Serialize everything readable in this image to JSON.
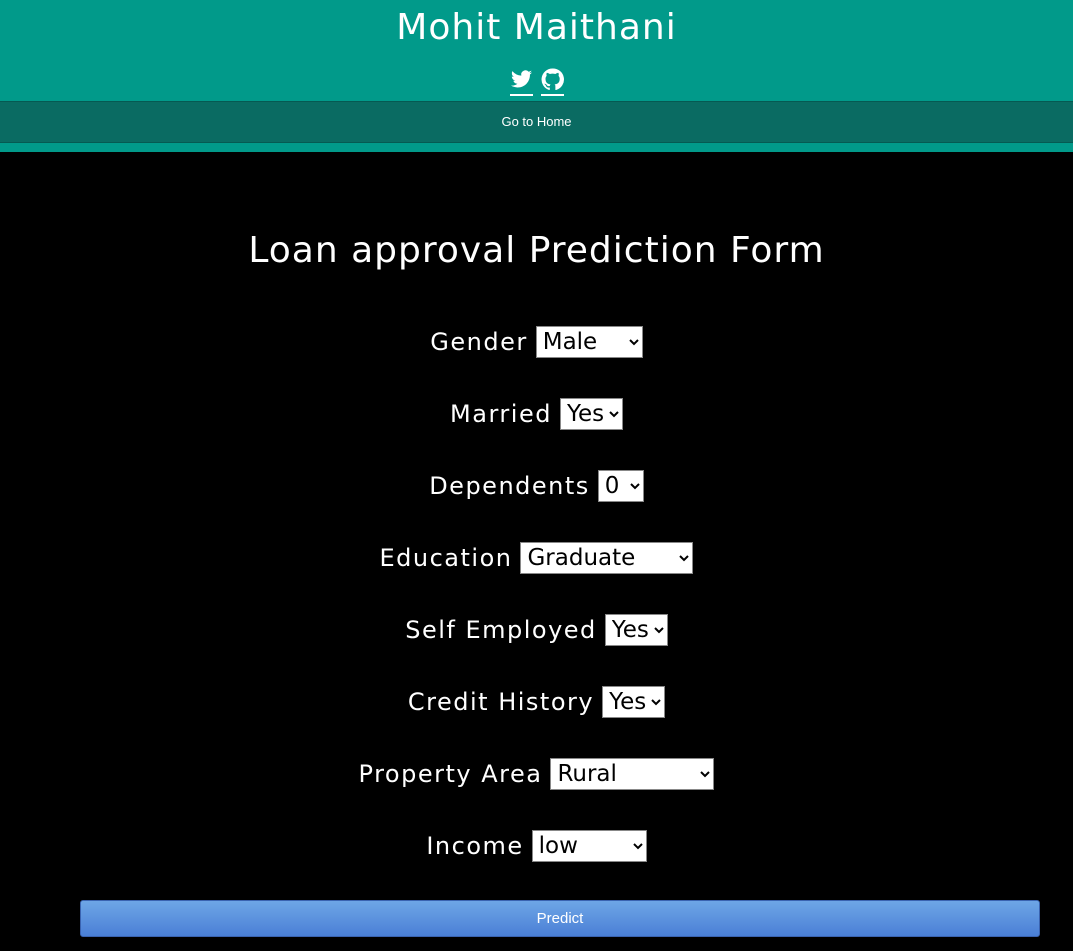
{
  "header": {
    "title": "Mohit Maithani",
    "social_icons": [
      "twitter-icon",
      "github-icon"
    ]
  },
  "nav": {
    "home_link": "Go to Home"
  },
  "form": {
    "title": "Loan approval Prediction Form",
    "fields": [
      {
        "label": "Gender",
        "value": "Male"
      },
      {
        "label": "Married",
        "value": "Yes"
      },
      {
        "label": "Dependents",
        "value": "0"
      },
      {
        "label": "Education",
        "value": "Graduate"
      },
      {
        "label": "Self Employed",
        "value": "Yes"
      },
      {
        "label": "Credit History",
        "value": "Yes"
      },
      {
        "label": "Property Area",
        "value": "Rural"
      },
      {
        "label": "Income",
        "value": "low"
      }
    ],
    "submit_label": "Predict"
  },
  "colors": {
    "header_bg": "#019a8a",
    "navbar_bg": "#0a6b62",
    "page_bg": "#000000",
    "button_bg": "#5b92df"
  }
}
